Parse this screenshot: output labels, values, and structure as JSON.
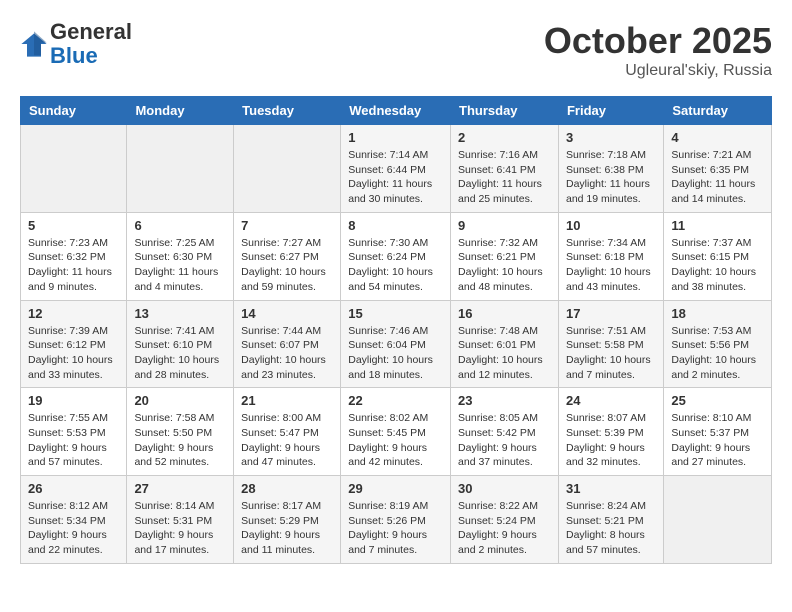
{
  "header": {
    "logo_line1": "General",
    "logo_line2": "Blue",
    "month": "October 2025",
    "location": "Ugleural'skiy, Russia"
  },
  "days_of_week": [
    "Sunday",
    "Monday",
    "Tuesday",
    "Wednesday",
    "Thursday",
    "Friday",
    "Saturday"
  ],
  "weeks": [
    [
      {
        "day": "",
        "info": ""
      },
      {
        "day": "",
        "info": ""
      },
      {
        "day": "",
        "info": ""
      },
      {
        "day": "1",
        "info": "Sunrise: 7:14 AM\nSunset: 6:44 PM\nDaylight: 11 hours\nand 30 minutes."
      },
      {
        "day": "2",
        "info": "Sunrise: 7:16 AM\nSunset: 6:41 PM\nDaylight: 11 hours\nand 25 minutes."
      },
      {
        "day": "3",
        "info": "Sunrise: 7:18 AM\nSunset: 6:38 PM\nDaylight: 11 hours\nand 19 minutes."
      },
      {
        "day": "4",
        "info": "Sunrise: 7:21 AM\nSunset: 6:35 PM\nDaylight: 11 hours\nand 14 minutes."
      }
    ],
    [
      {
        "day": "5",
        "info": "Sunrise: 7:23 AM\nSunset: 6:32 PM\nDaylight: 11 hours\nand 9 minutes."
      },
      {
        "day": "6",
        "info": "Sunrise: 7:25 AM\nSunset: 6:30 PM\nDaylight: 11 hours\nand 4 minutes."
      },
      {
        "day": "7",
        "info": "Sunrise: 7:27 AM\nSunset: 6:27 PM\nDaylight: 10 hours\nand 59 minutes."
      },
      {
        "day": "8",
        "info": "Sunrise: 7:30 AM\nSunset: 6:24 PM\nDaylight: 10 hours\nand 54 minutes."
      },
      {
        "day": "9",
        "info": "Sunrise: 7:32 AM\nSunset: 6:21 PM\nDaylight: 10 hours\nand 48 minutes."
      },
      {
        "day": "10",
        "info": "Sunrise: 7:34 AM\nSunset: 6:18 PM\nDaylight: 10 hours\nand 43 minutes."
      },
      {
        "day": "11",
        "info": "Sunrise: 7:37 AM\nSunset: 6:15 PM\nDaylight: 10 hours\nand 38 minutes."
      }
    ],
    [
      {
        "day": "12",
        "info": "Sunrise: 7:39 AM\nSunset: 6:12 PM\nDaylight: 10 hours\nand 33 minutes."
      },
      {
        "day": "13",
        "info": "Sunrise: 7:41 AM\nSunset: 6:10 PM\nDaylight: 10 hours\nand 28 minutes."
      },
      {
        "day": "14",
        "info": "Sunrise: 7:44 AM\nSunset: 6:07 PM\nDaylight: 10 hours\nand 23 minutes."
      },
      {
        "day": "15",
        "info": "Sunrise: 7:46 AM\nSunset: 6:04 PM\nDaylight: 10 hours\nand 18 minutes."
      },
      {
        "day": "16",
        "info": "Sunrise: 7:48 AM\nSunset: 6:01 PM\nDaylight: 10 hours\nand 12 minutes."
      },
      {
        "day": "17",
        "info": "Sunrise: 7:51 AM\nSunset: 5:58 PM\nDaylight: 10 hours\nand 7 minutes."
      },
      {
        "day": "18",
        "info": "Sunrise: 7:53 AM\nSunset: 5:56 PM\nDaylight: 10 hours\nand 2 minutes."
      }
    ],
    [
      {
        "day": "19",
        "info": "Sunrise: 7:55 AM\nSunset: 5:53 PM\nDaylight: 9 hours\nand 57 minutes."
      },
      {
        "day": "20",
        "info": "Sunrise: 7:58 AM\nSunset: 5:50 PM\nDaylight: 9 hours\nand 52 minutes."
      },
      {
        "day": "21",
        "info": "Sunrise: 8:00 AM\nSunset: 5:47 PM\nDaylight: 9 hours\nand 47 minutes."
      },
      {
        "day": "22",
        "info": "Sunrise: 8:02 AM\nSunset: 5:45 PM\nDaylight: 9 hours\nand 42 minutes."
      },
      {
        "day": "23",
        "info": "Sunrise: 8:05 AM\nSunset: 5:42 PM\nDaylight: 9 hours\nand 37 minutes."
      },
      {
        "day": "24",
        "info": "Sunrise: 8:07 AM\nSunset: 5:39 PM\nDaylight: 9 hours\nand 32 minutes."
      },
      {
        "day": "25",
        "info": "Sunrise: 8:10 AM\nSunset: 5:37 PM\nDaylight: 9 hours\nand 27 minutes."
      }
    ],
    [
      {
        "day": "26",
        "info": "Sunrise: 8:12 AM\nSunset: 5:34 PM\nDaylight: 9 hours\nand 22 minutes."
      },
      {
        "day": "27",
        "info": "Sunrise: 8:14 AM\nSunset: 5:31 PM\nDaylight: 9 hours\nand 17 minutes."
      },
      {
        "day": "28",
        "info": "Sunrise: 8:17 AM\nSunset: 5:29 PM\nDaylight: 9 hours\nand 11 minutes."
      },
      {
        "day": "29",
        "info": "Sunrise: 8:19 AM\nSunset: 5:26 PM\nDaylight: 9 hours\nand 7 minutes."
      },
      {
        "day": "30",
        "info": "Sunrise: 8:22 AM\nSunset: 5:24 PM\nDaylight: 9 hours\nand 2 minutes."
      },
      {
        "day": "31",
        "info": "Sunrise: 8:24 AM\nSunset: 5:21 PM\nDaylight: 8 hours\nand 57 minutes."
      },
      {
        "day": "",
        "info": ""
      }
    ]
  ]
}
